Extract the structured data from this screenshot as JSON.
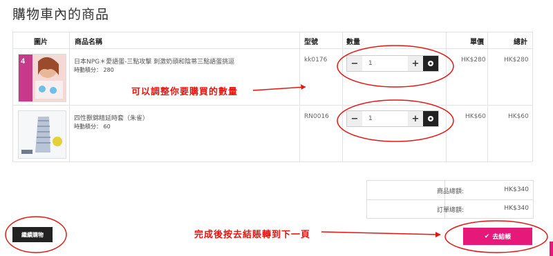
{
  "page": {
    "title": "購物車內的商品"
  },
  "table": {
    "headers": {
      "image": "圖片",
      "name": "商品名稱",
      "model": "型號",
      "qty": "數量",
      "unit_price": "單價",
      "total": "總計"
    },
    "rows": [
      {
        "name": "日本NPG＊愛語蛋-三點攻擊 刺激奶頭和陰蒂三點語蛋挑逗",
        "points": "時動積分： 280",
        "model": "kk0176",
        "qty": "1",
        "unit_price": "HK$280",
        "total": "HK$280"
      },
      {
        "name": "四性獸錦精延時套（朱雀）",
        "points": "時動積分： 60",
        "model": "RN0016",
        "qty": "1",
        "unit_price": "HK$60",
        "total": "HK$60"
      }
    ]
  },
  "summary": {
    "subtotal_label": "商品總額:",
    "subtotal_value": "HK$340",
    "order_label": "訂單總額:",
    "order_value": "HK$340"
  },
  "buttons": {
    "continue": "繼續購物",
    "checkout": "去結帳"
  },
  "annotations": {
    "adjust_qty": "可以調整你要購買的數量",
    "proceed": "完成後按去結賬轉到下一頁"
  },
  "colors": {
    "accent": "#e6197a",
    "annotation": "#e8140f"
  }
}
